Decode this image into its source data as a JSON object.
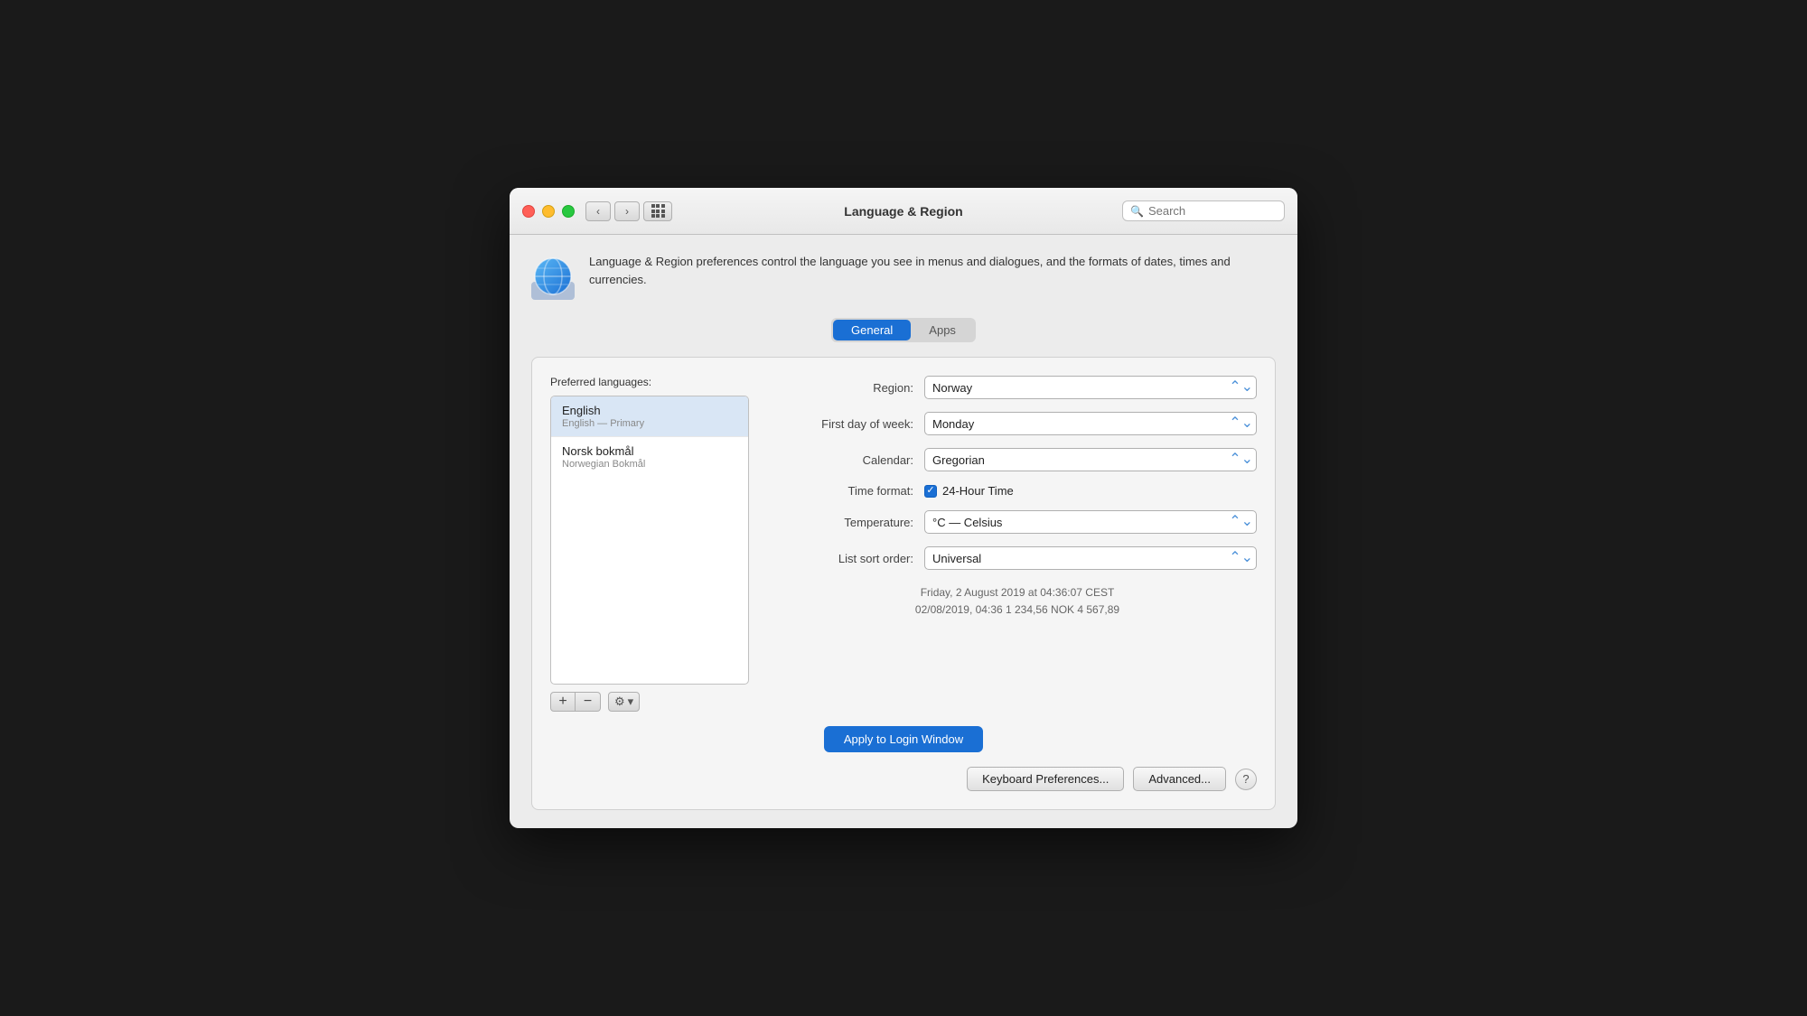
{
  "titlebar": {
    "title": "Language & Region",
    "search_placeholder": "Search"
  },
  "description": {
    "text": "Language & Region preferences control the language you see in menus and dialogues, and the formats of dates, times and currencies."
  },
  "tabs": {
    "general": "General",
    "apps": "Apps",
    "active": "general"
  },
  "languages_section": {
    "label": "Preferred languages:",
    "items": [
      {
        "name": "English",
        "sub": "English — Primary",
        "selected": true
      },
      {
        "name": "Norsk bokmål",
        "sub": "Norwegian Bokmål",
        "selected": false
      }
    ],
    "add_btn": "+",
    "remove_btn": "−"
  },
  "settings": {
    "region_label": "Region:",
    "region_value": "Norway",
    "week_label": "First day of week:",
    "week_value": "Monday",
    "calendar_label": "Calendar:",
    "calendar_value": "Gregorian",
    "time_format_label": "Time format:",
    "time_format_checkbox": "24-Hour Time",
    "temperature_label": "Temperature:",
    "temperature_value": "°C — Celsius",
    "sort_label": "List sort order:",
    "sort_value": "Universal",
    "date_line1": "Friday, 2 August 2019 at 04:36:07 CEST",
    "date_line2": "02/08/2019, 04:36      1 234,56     NOK 4 567,89"
  },
  "buttons": {
    "apply": "Apply to Login Window",
    "keyboard": "Keyboard Preferences...",
    "advanced": "Advanced...",
    "help": "?"
  }
}
